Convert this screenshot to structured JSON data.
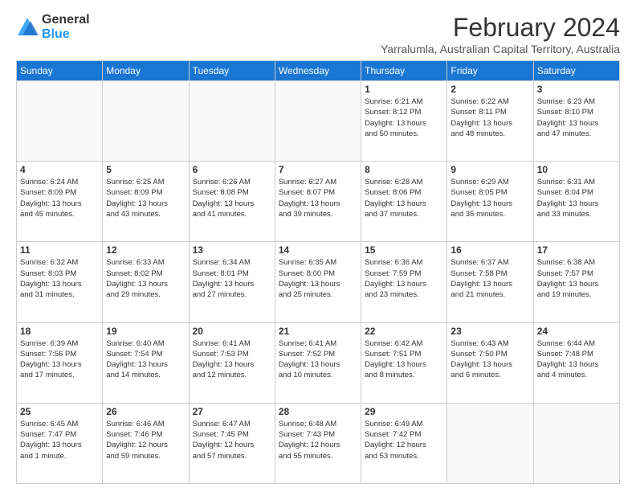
{
  "logo": {
    "general": "General",
    "blue": "Blue"
  },
  "title": "February 2024",
  "subtitle": "Yarralumla, Australian Capital Territory, Australia",
  "calendar": {
    "headers": [
      "Sunday",
      "Monday",
      "Tuesday",
      "Wednesday",
      "Thursday",
      "Friday",
      "Saturday"
    ],
    "weeks": [
      [
        {
          "day": "",
          "info": ""
        },
        {
          "day": "",
          "info": ""
        },
        {
          "day": "",
          "info": ""
        },
        {
          "day": "",
          "info": ""
        },
        {
          "day": "1",
          "info": "Sunrise: 6:21 AM\nSunset: 8:12 PM\nDaylight: 13 hours\nand 50 minutes."
        },
        {
          "day": "2",
          "info": "Sunrise: 6:22 AM\nSunset: 8:11 PM\nDaylight: 13 hours\nand 48 minutes."
        },
        {
          "day": "3",
          "info": "Sunrise: 6:23 AM\nSunset: 8:10 PM\nDaylight: 13 hours\nand 47 minutes."
        }
      ],
      [
        {
          "day": "4",
          "info": "Sunrise: 6:24 AM\nSunset: 8:09 PM\nDaylight: 13 hours\nand 45 minutes."
        },
        {
          "day": "5",
          "info": "Sunrise: 6:25 AM\nSunset: 8:09 PM\nDaylight: 13 hours\nand 43 minutes."
        },
        {
          "day": "6",
          "info": "Sunrise: 6:26 AM\nSunset: 8:08 PM\nDaylight: 13 hours\nand 41 minutes."
        },
        {
          "day": "7",
          "info": "Sunrise: 6:27 AM\nSunset: 8:07 PM\nDaylight: 13 hours\nand 39 minutes."
        },
        {
          "day": "8",
          "info": "Sunrise: 6:28 AM\nSunset: 8:06 PM\nDaylight: 13 hours\nand 37 minutes."
        },
        {
          "day": "9",
          "info": "Sunrise: 6:29 AM\nSunset: 8:05 PM\nDaylight: 13 hours\nand 35 minutes."
        },
        {
          "day": "10",
          "info": "Sunrise: 6:31 AM\nSunset: 8:04 PM\nDaylight: 13 hours\nand 33 minutes."
        }
      ],
      [
        {
          "day": "11",
          "info": "Sunrise: 6:32 AM\nSunset: 8:03 PM\nDaylight: 13 hours\nand 31 minutes."
        },
        {
          "day": "12",
          "info": "Sunrise: 6:33 AM\nSunset: 8:02 PM\nDaylight: 13 hours\nand 29 minutes."
        },
        {
          "day": "13",
          "info": "Sunrise: 6:34 AM\nSunset: 8:01 PM\nDaylight: 13 hours\nand 27 minutes."
        },
        {
          "day": "14",
          "info": "Sunrise: 6:35 AM\nSunset: 8:00 PM\nDaylight: 13 hours\nand 25 minutes."
        },
        {
          "day": "15",
          "info": "Sunrise: 6:36 AM\nSunset: 7:59 PM\nDaylight: 13 hours\nand 23 minutes."
        },
        {
          "day": "16",
          "info": "Sunrise: 6:37 AM\nSunset: 7:58 PM\nDaylight: 13 hours\nand 21 minutes."
        },
        {
          "day": "17",
          "info": "Sunrise: 6:38 AM\nSunset: 7:57 PM\nDaylight: 13 hours\nand 19 minutes."
        }
      ],
      [
        {
          "day": "18",
          "info": "Sunrise: 6:39 AM\nSunset: 7:56 PM\nDaylight: 13 hours\nand 17 minutes."
        },
        {
          "day": "19",
          "info": "Sunrise: 6:40 AM\nSunset: 7:54 PM\nDaylight: 13 hours\nand 14 minutes."
        },
        {
          "day": "20",
          "info": "Sunrise: 6:41 AM\nSunset: 7:53 PM\nDaylight: 13 hours\nand 12 minutes."
        },
        {
          "day": "21",
          "info": "Sunrise: 6:41 AM\nSunset: 7:52 PM\nDaylight: 13 hours\nand 10 minutes."
        },
        {
          "day": "22",
          "info": "Sunrise: 6:42 AM\nSunset: 7:51 PM\nDaylight: 13 hours\nand 8 minutes."
        },
        {
          "day": "23",
          "info": "Sunrise: 6:43 AM\nSunset: 7:50 PM\nDaylight: 13 hours\nand 6 minutes."
        },
        {
          "day": "24",
          "info": "Sunrise: 6:44 AM\nSunset: 7:48 PM\nDaylight: 13 hours\nand 4 minutes."
        }
      ],
      [
        {
          "day": "25",
          "info": "Sunrise: 6:45 AM\nSunset: 7:47 PM\nDaylight: 13 hours\nand 1 minute."
        },
        {
          "day": "26",
          "info": "Sunrise: 6:46 AM\nSunset: 7:46 PM\nDaylight: 12 hours\nand 59 minutes."
        },
        {
          "day": "27",
          "info": "Sunrise: 6:47 AM\nSunset: 7:45 PM\nDaylight: 12 hours\nand 57 minutes."
        },
        {
          "day": "28",
          "info": "Sunrise: 6:48 AM\nSunset: 7:43 PM\nDaylight: 12 hours\nand 55 minutes."
        },
        {
          "day": "29",
          "info": "Sunrise: 6:49 AM\nSunset: 7:42 PM\nDaylight: 12 hours\nand 53 minutes."
        },
        {
          "day": "",
          "info": ""
        },
        {
          "day": "",
          "info": ""
        }
      ]
    ]
  }
}
